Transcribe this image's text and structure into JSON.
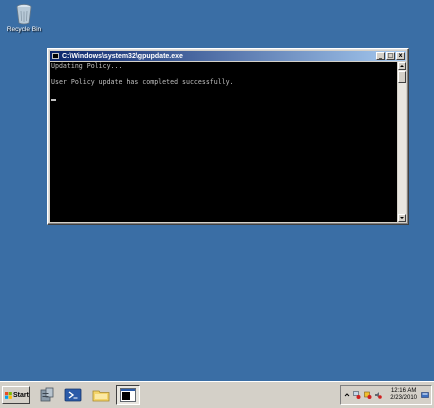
{
  "desktop": {
    "recycle_bin_label": "Recycle Bin"
  },
  "window": {
    "title": "C:\\Windows\\system32\\gpupdate.exe",
    "buttons": {
      "minimize": "_",
      "maximize": "□",
      "close": "x"
    },
    "console_lines": [
      "Updating Policy...",
      "",
      "User Policy update has completed successfully.",
      ""
    ]
  },
  "taskbar": {
    "start_label": "Start",
    "clock_time": "12:16 AM",
    "clock_date": "2/23/2010"
  },
  "colors": {
    "desktop_bg": "#3a6ea5",
    "titlebar_start": "#0a246a",
    "titlebar_end": "#a6caf0",
    "console_bg": "#000000",
    "console_text": "#c0c0c0"
  }
}
